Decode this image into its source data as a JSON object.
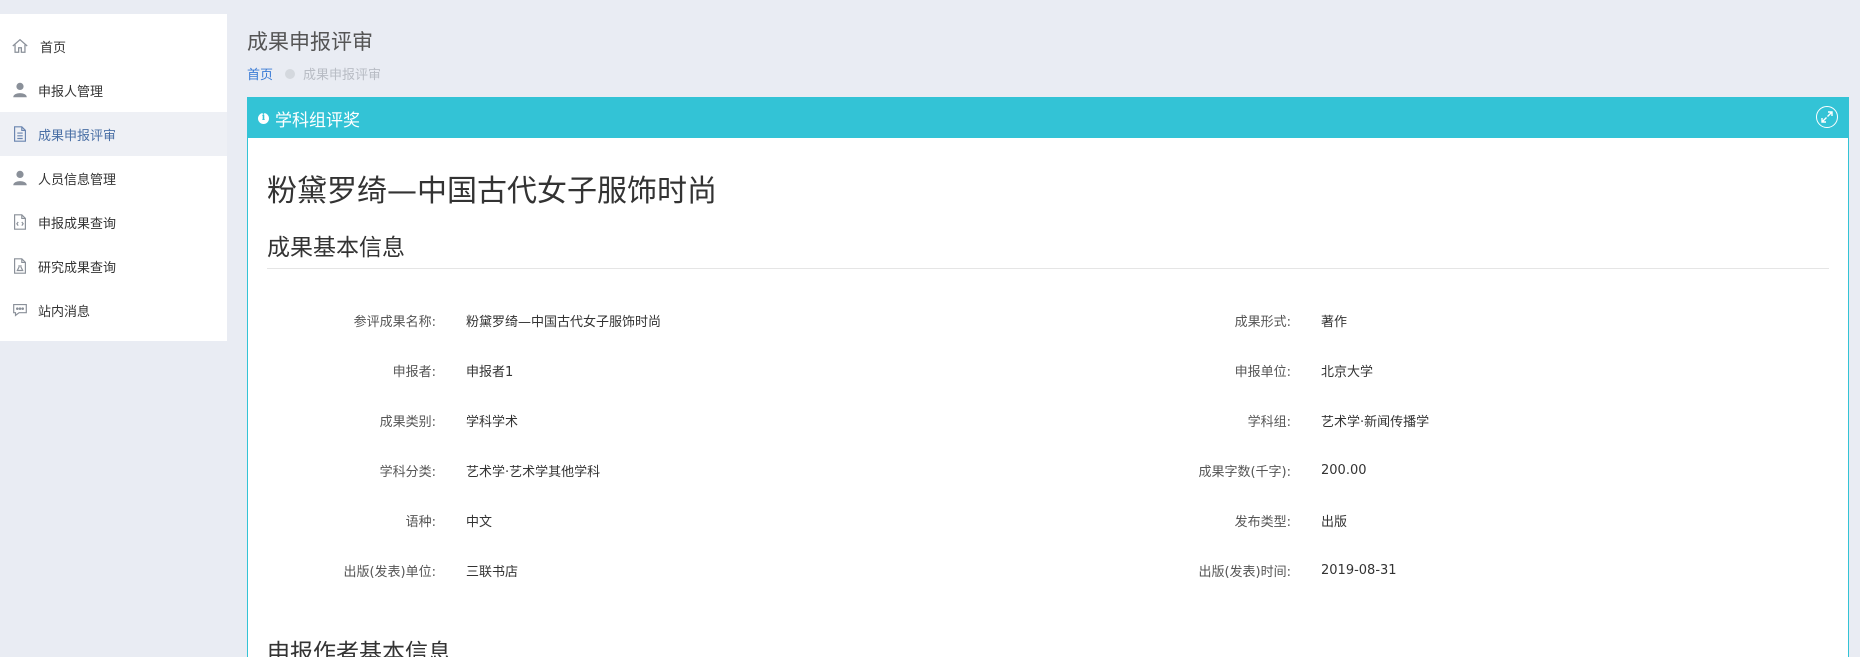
{
  "sidebar": {
    "items": [
      {
        "label": "首页",
        "icon": "home-icon"
      },
      {
        "label": "申报人管理",
        "icon": "user-icon"
      },
      {
        "label": "成果申报评审",
        "icon": "document-icon"
      },
      {
        "label": "人员信息管理",
        "icon": "user-icon"
      },
      {
        "label": "申报成果查询",
        "icon": "code-file-icon"
      },
      {
        "label": "研究成果查询",
        "icon": "flask-file-icon"
      },
      {
        "label": "站内消息",
        "icon": "chat-icon"
      }
    ],
    "active_index": 2
  },
  "header": {
    "title": "成果申报评审",
    "breadcrumb": {
      "home": "首页",
      "current": "成果申报评审"
    }
  },
  "panel": {
    "title": "学科组评奖",
    "work_title": "粉黛罗绮—中国古代女子服饰时尚",
    "section_basic": "成果基本信息",
    "section_author": "申报作者基本信息",
    "fields": [
      {
        "label": "参评成果名称:",
        "value": "粉黛罗绮—中国古代女子服饰时尚",
        "label2": "成果形式:",
        "value2": "著作"
      },
      {
        "label": "申报者:",
        "value": "申报者1",
        "label2": "申报单位:",
        "value2": "北京大学"
      },
      {
        "label": "成果类别:",
        "value": "学科学术",
        "label2": "学科组:",
        "value2": "艺术学·新闻传播学"
      },
      {
        "label": "学科分类:",
        "value": "艺术学·艺术学其他学科",
        "label2": "成果字数(千字):",
        "value2": "200.00"
      },
      {
        "label": "语种:",
        "value": "中文",
        "label2": "发布类型:",
        "value2": "出版"
      },
      {
        "label": "出版(发表)单位:",
        "value": "三联书店",
        "label2": "出版(发表)时间:",
        "value2": "2019-08-31"
      }
    ]
  },
  "colors": {
    "accent": "#33c3d6",
    "link": "#3a7bd5",
    "background": "#e9ecf3"
  }
}
